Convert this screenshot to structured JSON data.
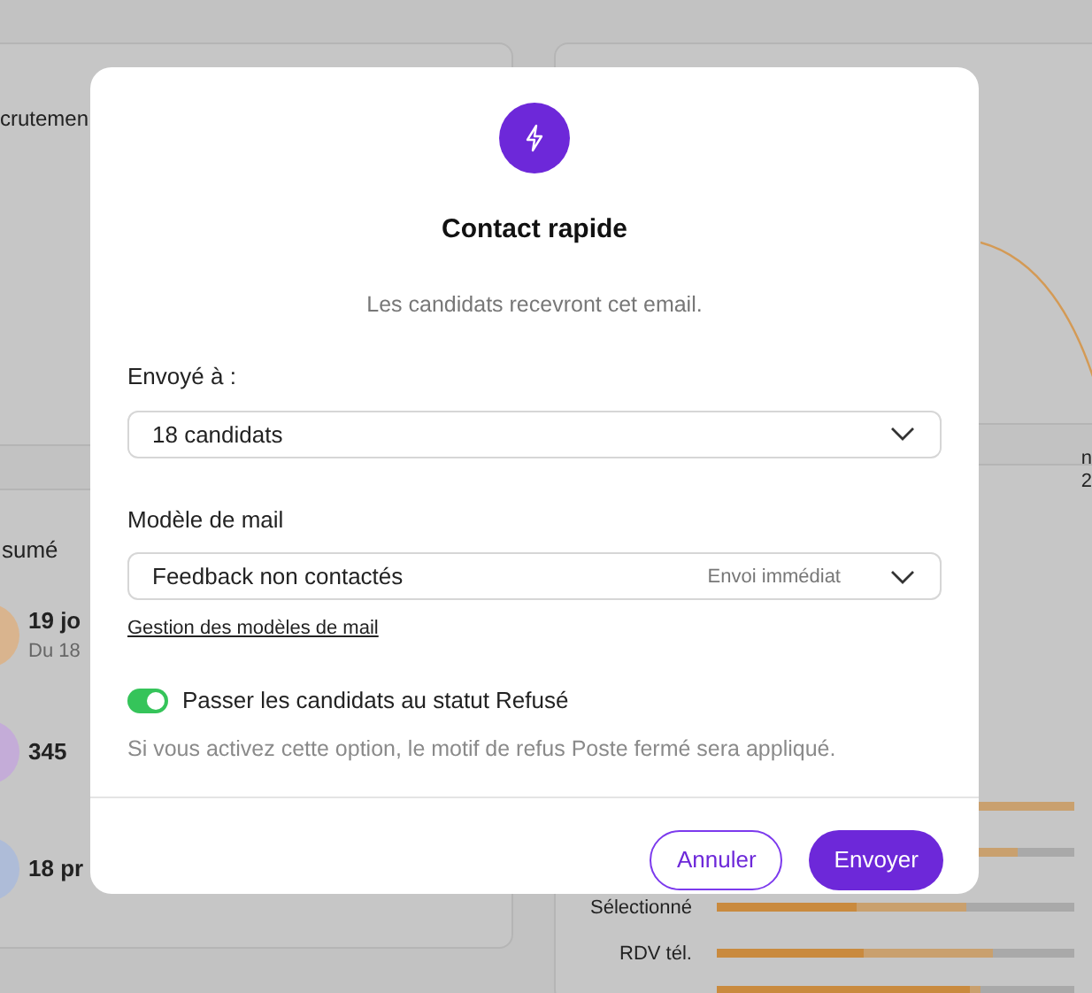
{
  "background": {
    "left_cards": [
      {
        "title": "crutemen"
      },
      {
        "title": "sumé",
        "stats": [
          {
            "value": "19 jo",
            "detail": "Du 18",
            "color": "#d9b48e"
          },
          {
            "value": "345",
            "color": "#c4acd8"
          },
          {
            "value": "18 pr",
            "color": "#aebcd8"
          }
        ]
      }
    ],
    "right_edge_texts": [
      "n",
      "2"
    ],
    "bars": [
      {
        "fills": [
          {
            "kind": "total",
            "level": 1.0
          }
        ]
      },
      {
        "fills": [
          {
            "kind": "total",
            "level": 0.84
          }
        ]
      },
      {
        "label": "Sélectionné",
        "fills": [
          {
            "kind": "total",
            "level": 0.7
          },
          {
            "kind": "done",
            "level": 0.39
          }
        ]
      },
      {
        "label": "RDV tél.",
        "fills": [
          {
            "kind": "total",
            "level": 0.77
          },
          {
            "kind": "done",
            "level": 0.41
          }
        ]
      },
      {
        "fills": [
          {
            "kind": "total",
            "level": 0.74
          },
          {
            "kind": "done",
            "level": 0.71
          }
        ]
      }
    ]
  },
  "dialog": {
    "title": "Contact rapide",
    "subtitle": "Les candidats recevront cet email.",
    "recipients": {
      "label": "Envoyé à :",
      "value": "18 candidats"
    },
    "template": {
      "label": "Modèle de mail",
      "value": "Feedback non contactés",
      "hint": "Envoi immédiat",
      "link": "Gestion des modèles de mail"
    },
    "status_toggle": {
      "label": "Passer les candidats au statut Refusé",
      "on": true,
      "help": "Si vous activez cette option, le motif de refus Poste fermé sera appliqué."
    },
    "buttons": [
      {
        "label": "Annuler",
        "kind": "secondary"
      },
      {
        "label": "Envoyer",
        "kind": "primary"
      }
    ]
  }
}
